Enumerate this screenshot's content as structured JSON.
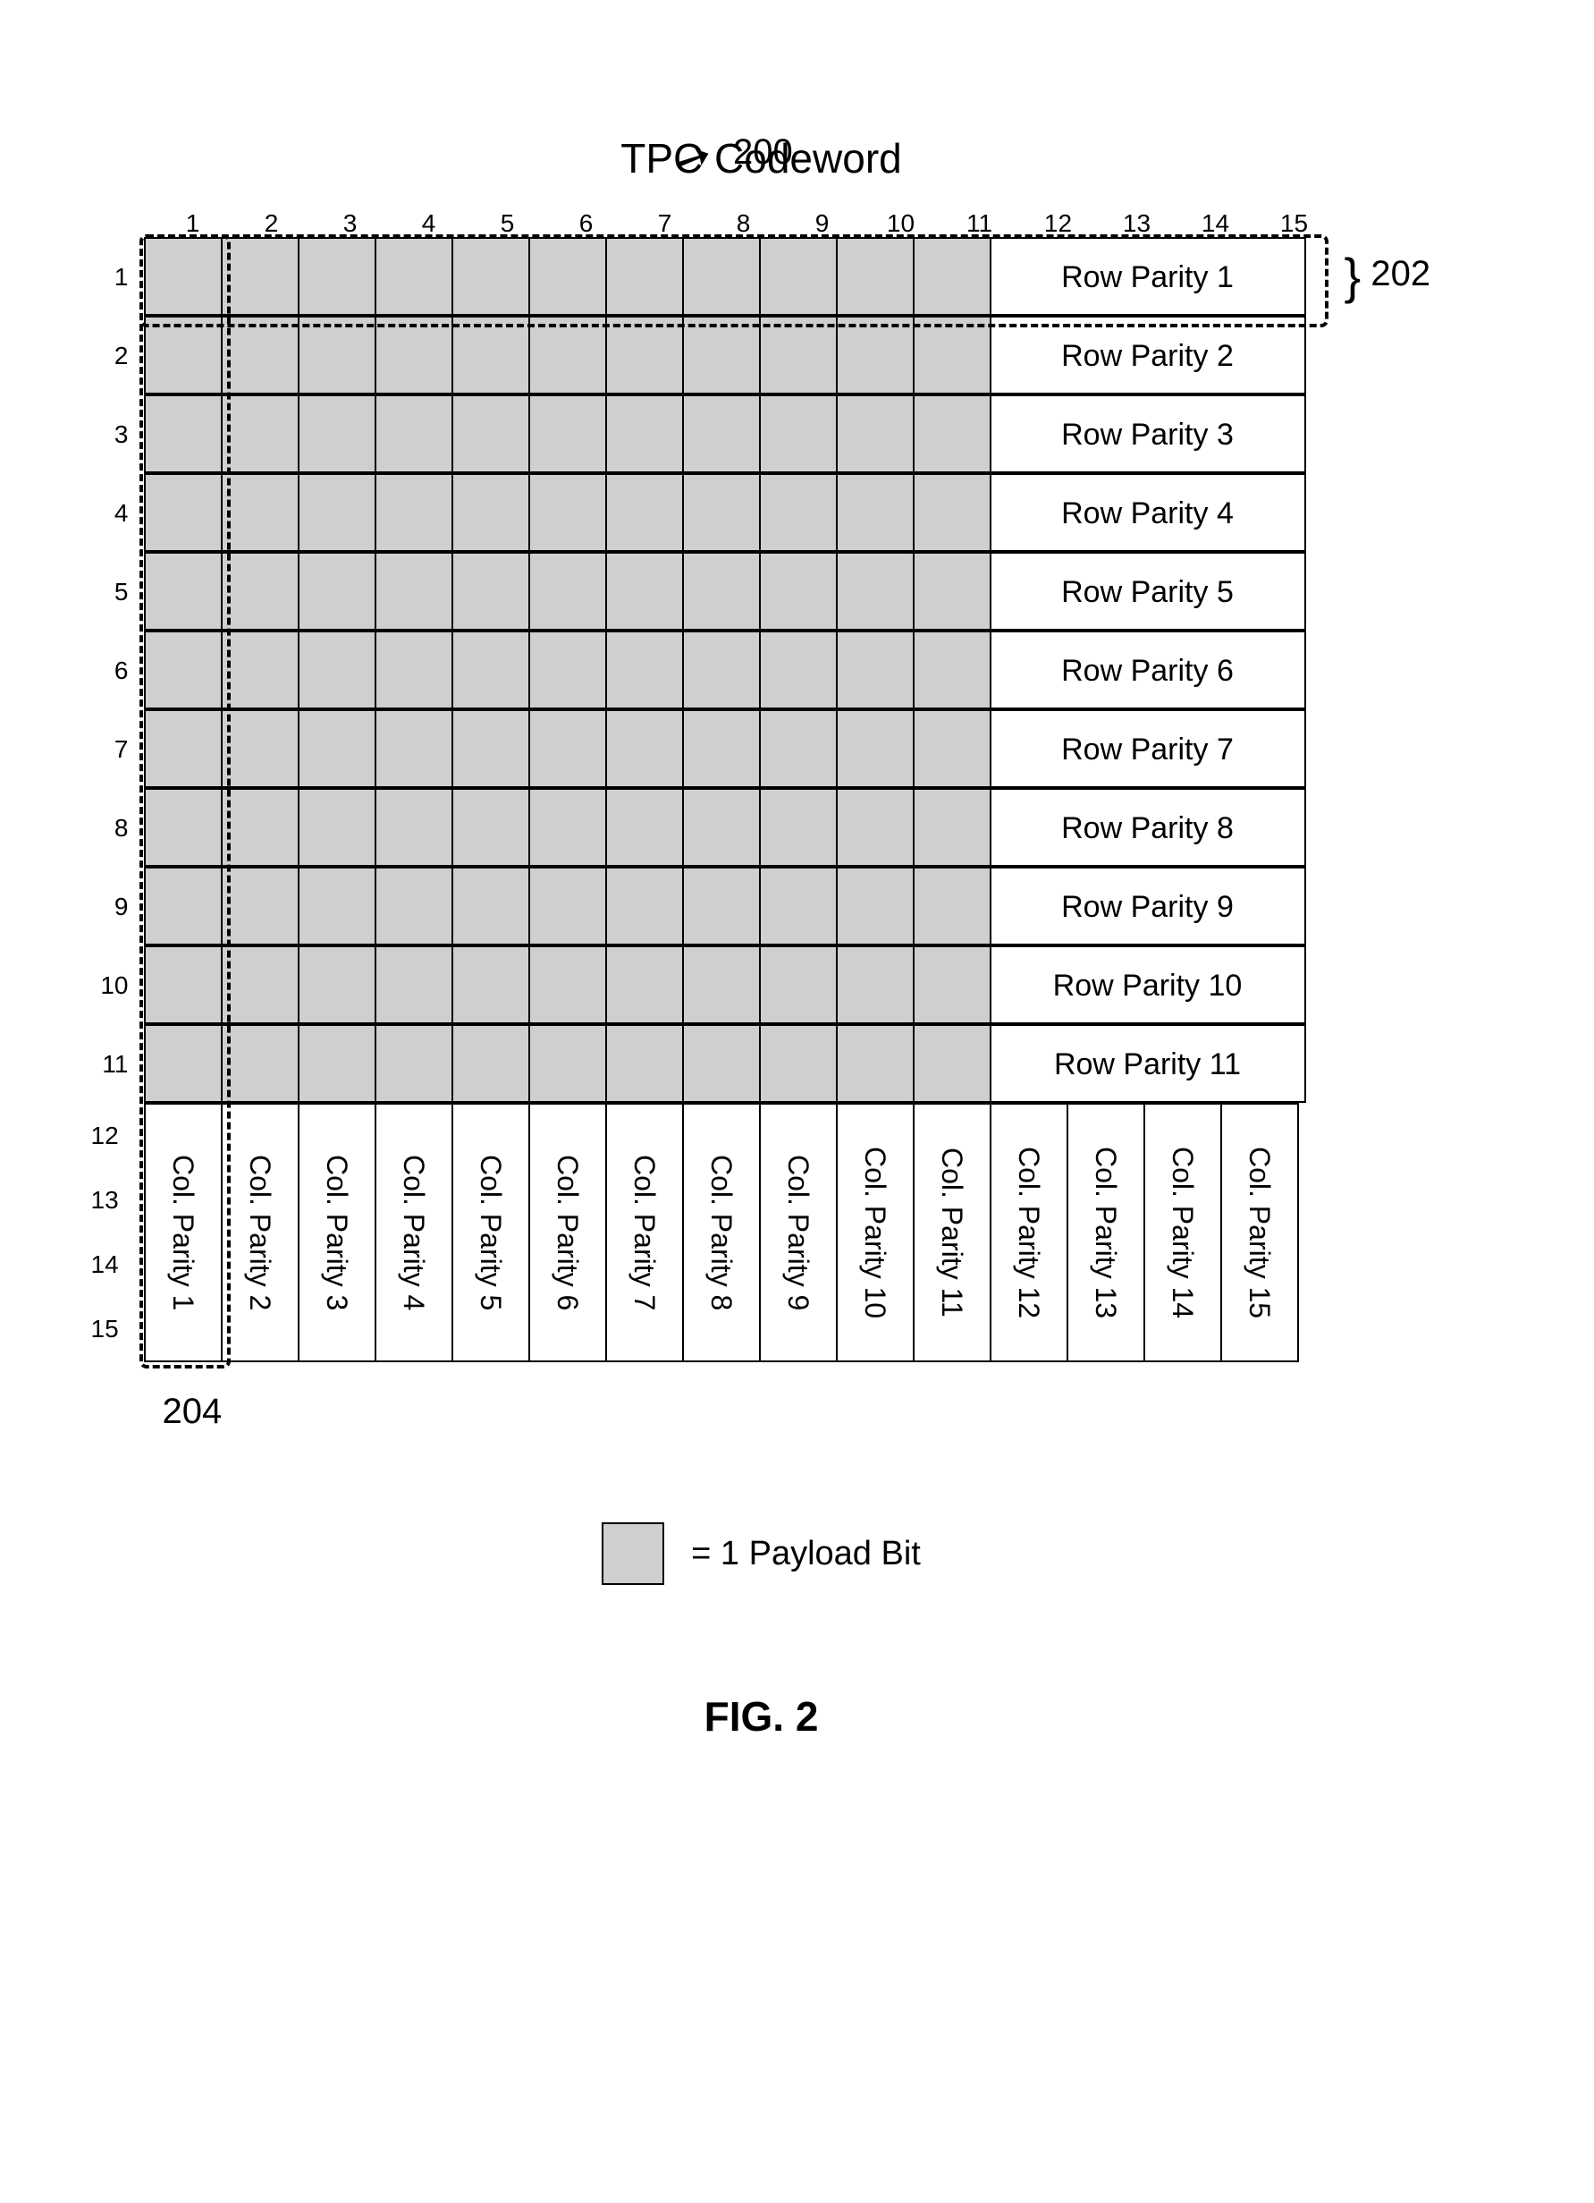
{
  "ref_number": "200",
  "title": "TPC Codeword",
  "callout_row": "202",
  "callout_col": "204",
  "col_headers": [
    "1",
    "2",
    "3",
    "4",
    "5",
    "6",
    "7",
    "8",
    "9",
    "10",
    "11",
    "12",
    "13",
    "14",
    "15"
  ],
  "row_labels": [
    "1",
    "2",
    "3",
    "4",
    "5",
    "6",
    "7",
    "8",
    "9",
    "10",
    "11",
    "12",
    "13",
    "14",
    "15"
  ],
  "payload_cols": 11,
  "payload_rows": 11,
  "row_parity": [
    "Row Parity 1",
    "Row Parity 2",
    "Row Parity 3",
    "Row Parity 4",
    "Row Parity 5",
    "Row Parity 6",
    "Row Parity 7",
    "Row Parity 8",
    "Row Parity 9",
    "Row Parity 10",
    "Row Parity 11"
  ],
  "col_parity": [
    "Col. Parity 1",
    "Col. Parity 2",
    "Col. Parity 3",
    "Col. Parity 4",
    "Col. Parity 5",
    "Col. Parity 6",
    "Col. Parity 7",
    "Col. Parity 8",
    "Col. Parity 9",
    "Col. Parity 10",
    "Col. Parity 11",
    "Col. Parity 12",
    "Col. Parity 13",
    "Col. Parity 14",
    "Col. Parity 15"
  ],
  "legend_label": "= 1 Payload Bit",
  "figure_label": "FIG. 2"
}
